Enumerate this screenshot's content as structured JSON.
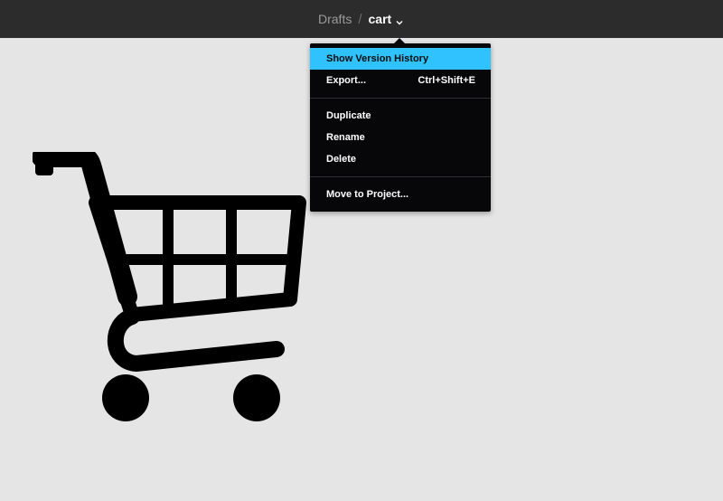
{
  "breadcrumb": {
    "parent": "Drafts",
    "separator": "/",
    "current": "cart"
  },
  "menu": {
    "items": [
      {
        "label": "Show Version History",
        "shortcut": "",
        "active": true
      },
      {
        "label": "Export...",
        "shortcut": "Ctrl+Shift+E",
        "active": false
      },
      {
        "label": "Duplicate",
        "shortcut": "",
        "active": false
      },
      {
        "label": "Rename",
        "shortcut": "",
        "active": false
      },
      {
        "label": "Delete",
        "shortcut": "",
        "active": false
      },
      {
        "label": "Move to Project...",
        "shortcut": "",
        "active": false
      }
    ]
  },
  "canvas": {
    "artwork": "shopping-cart-icon"
  },
  "colors": {
    "topbar": "#2c2c2c",
    "canvas": "#e5e5e5",
    "menu_bg": "#070709",
    "menu_highlight": "#30c2ff",
    "artwork": "#000000"
  }
}
